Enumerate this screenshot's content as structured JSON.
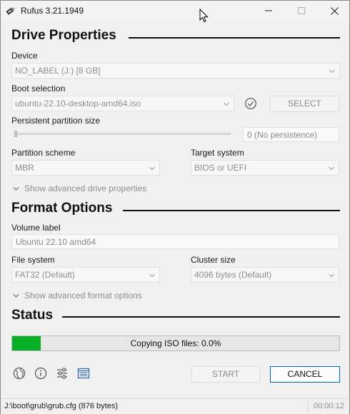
{
  "window": {
    "title": "Rufus 3.21.1949"
  },
  "sections": {
    "drive": "Drive Properties",
    "format": "Format Options",
    "status": "Status"
  },
  "device": {
    "label": "Device",
    "value": "NO_LABEL (J:) [8 GB]"
  },
  "boot": {
    "label": "Boot selection",
    "value": "ubuntu-22.10-desktop-amd64.iso",
    "select_label": "SELECT"
  },
  "persistent": {
    "label": "Persistent partition size",
    "value": "0 (No persistence)",
    "level": 0
  },
  "partition": {
    "label": "Partition scheme",
    "value": "MBR"
  },
  "target": {
    "label": "Target system",
    "value": "BIOS or UEFI"
  },
  "adv_drive": "Show advanced drive properties",
  "volume": {
    "label": "Volume label",
    "value": "Ubuntu 22.10 amd64"
  },
  "filesystem": {
    "label": "File system",
    "value": "FAT32 (Default)"
  },
  "cluster": {
    "label": "Cluster size",
    "value": "4096 bytes (Default)"
  },
  "adv_format": "Show advanced format options",
  "progress": {
    "text": "Copying ISO files: 0.0%",
    "fraction": 0.087,
    "color": "#06b025"
  },
  "buttons": {
    "start": "START",
    "cancel": "CANCEL"
  },
  "statusbar": {
    "left": "J:\\boot\\grub\\grub.cfg (876 bytes)",
    "right": "00:00:12"
  },
  "icons": [
    "globe-icon",
    "info-icon",
    "settings-icon",
    "log-icon"
  ]
}
